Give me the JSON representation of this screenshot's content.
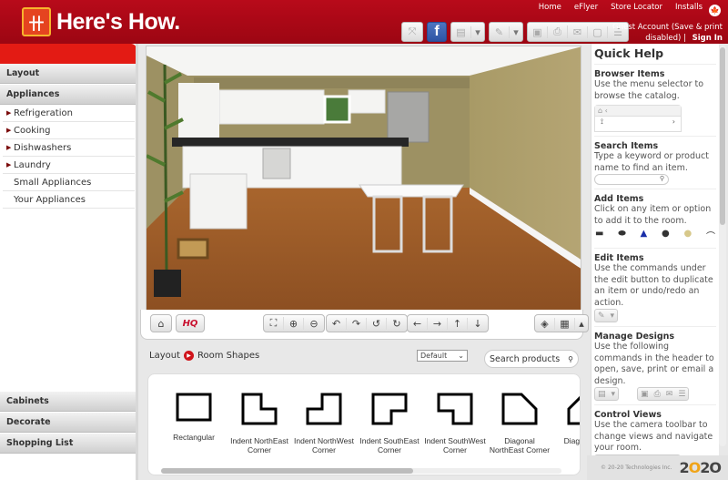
{
  "header": {
    "logo_mark": "卄",
    "logo_text": "Here's How.",
    "links": [
      "Home",
      "eFlyer",
      "Store Locator",
      "Installs"
    ],
    "account_text": "Guest Account (Save & print disabled)",
    "separator": "|",
    "sign_in": "Sign In",
    "tools": {
      "fullscreen_icon": "⤧",
      "facebook_label": "f",
      "open_icon": "▤",
      "edit_icon": "✎",
      "dropdown_icon": "▾",
      "save_icon": "💾",
      "print_icon": "⎙",
      "email_icon": "✉",
      "note_icon": "▢",
      "list_icon": "☰"
    }
  },
  "sidebar": {
    "sections": [
      {
        "label": "Layout"
      },
      {
        "label": "Appliances"
      }
    ],
    "items": [
      {
        "label": "Refrigeration",
        "expandable": true
      },
      {
        "label": "Cooking",
        "expandable": true
      },
      {
        "label": "Dishwashers",
        "expandable": true
      },
      {
        "label": "Laundry",
        "expandable": true
      },
      {
        "label": "Small Appliances",
        "expandable": false
      },
      {
        "label": "Your Appliances",
        "expandable": false
      }
    ],
    "bottom_sections": [
      {
        "label": "Cabinets"
      },
      {
        "label": "Decorate"
      },
      {
        "label": "Shopping List"
      }
    ],
    "arrow_icon": "▶"
  },
  "camera_toolbar": {
    "home": "⌂",
    "hq": "HQ",
    "fit": "⛶",
    "zoom_in": "⊕",
    "zoom_out": "⊖",
    "orbit": [
      "↶",
      "↷",
      "↺",
      "↻"
    ],
    "pan": [
      "←",
      "→",
      "↑",
      "↓"
    ],
    "view_3d": "◈",
    "view_2d": "▦",
    "more": "▴"
  },
  "browser": {
    "breadcrumb_root": "Layout",
    "breadcrumb_current": "Room Shapes",
    "breadcrumb_sep": "▶",
    "sort_value": "Default",
    "sort_arrow": "⌄",
    "search_placeholder": "Search products",
    "search_icon": "🔍",
    "shapes": [
      {
        "label": "Rectangular"
      },
      {
        "label": "Indent NorthEast Corner"
      },
      {
        "label": "Indent NorthWest Corner"
      },
      {
        "label": "Indent SouthEast Corner"
      },
      {
        "label": "Indent SouthWest Corner"
      },
      {
        "label": "Diagonal NorthEast Corner"
      },
      {
        "label": "Diagonal Co"
      }
    ]
  },
  "quick_help": {
    "title": "Quick Help",
    "sections": [
      {
        "title": "Browser Items",
        "text": "Use the menu selector to browse the catalog."
      },
      {
        "title": "Search Items",
        "text": "Type a keyword or product name to find an item."
      },
      {
        "title": "Add Items",
        "text": "Click on any item or option to add it to the room."
      },
      {
        "title": "Edit Items",
        "text": "Use the commands under the edit button to duplicate an item or undo/redo an action."
      },
      {
        "title": "Manage Designs",
        "text": "Use the following commands in the header to open, save, print or email a design."
      },
      {
        "title": "Control Views",
        "text": "Use the camera toolbar to change views and navigate your room."
      }
    ]
  },
  "footer": {
    "copyright": "© 20-20 Technologies Inc.",
    "brand_a": "2",
    "brand_o": "O",
    "brand_b": "2O"
  },
  "colors": {
    "brand_red": "#b80a1a",
    "sidebar_red": "#e31b14",
    "accent_orange": "#f0a418"
  }
}
